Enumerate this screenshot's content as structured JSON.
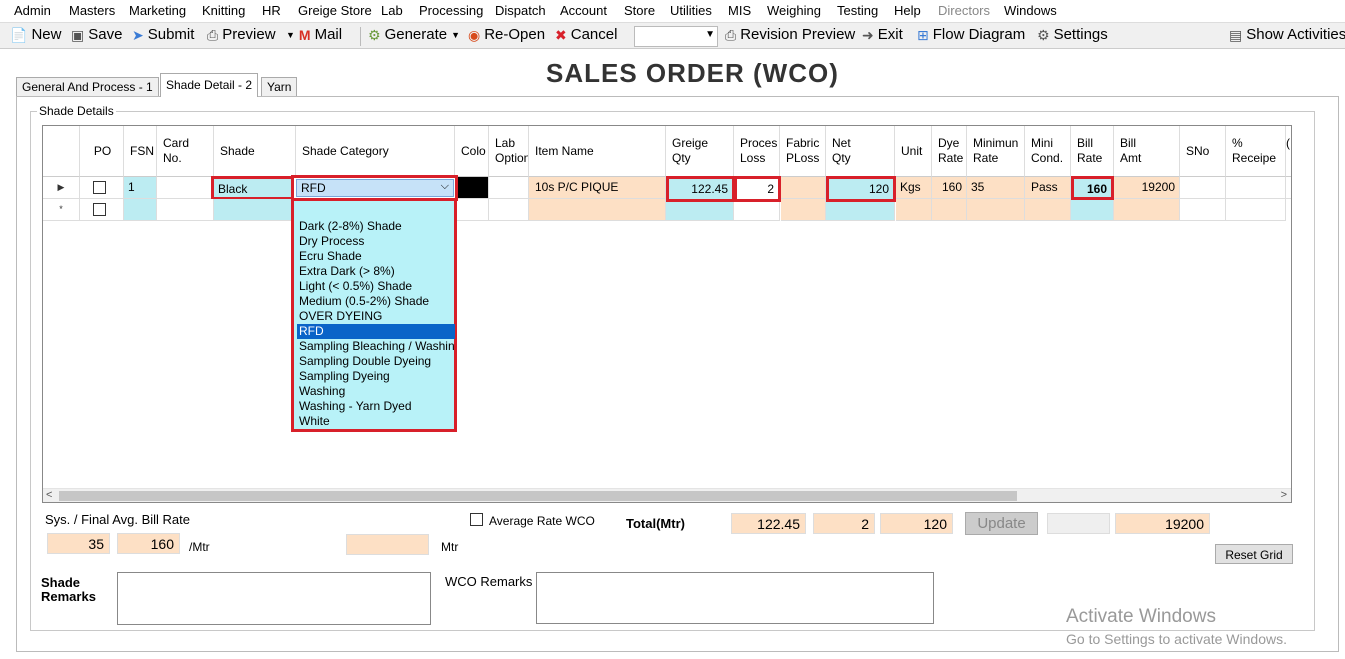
{
  "menu": [
    "Admin",
    "Masters",
    "Marketing",
    "Knitting",
    "HR",
    "Greige Store",
    "Lab",
    "Processing",
    "Dispatch",
    "Account",
    "Store",
    "Utilities",
    "MIS",
    "Weighing",
    "Testing",
    "Help",
    "Directors",
    "Windows"
  ],
  "toolbar": {
    "new": "New",
    "save": "Save",
    "submit": "Submit",
    "preview": "Preview",
    "mail": "Mail",
    "generate": "Generate",
    "reopen": "Re-Open",
    "cancel": "Cancel",
    "revision_preview": "Revision Preview",
    "exit": "Exit",
    "flow_diagram": "Flow Diagram",
    "settings": "Settings",
    "show_activities": "Show Activities"
  },
  "title": "SALES ORDER (WCO)",
  "tabs": [
    "General And Process - 1",
    "Shade Detail - 2",
    "Yarn"
  ],
  "group_title": "Shade Details",
  "grid": {
    "headers": {
      "po": "PO",
      "fsn": "FSN",
      "card_no": "Card\nNo.",
      "shade": "Shade",
      "shade_category": "Shade Category",
      "color": "Colo",
      "lab_option": "Lab\nOption",
      "item_name": "Item Name",
      "greige_qty": "Greige\nQty",
      "process_loss": "Proces\nLoss",
      "fabric_ploss": "Fabric\nPLoss",
      "net_qty": "Net\nQty",
      "unit": "Unit",
      "dye_rate": "Dye\nRate",
      "minimum_rate": "Minimun\nRate",
      "mini_cond": "Mini\nCond.",
      "bill_rate": "Bill\nRate",
      "bill_amt": "Bill\nAmt",
      "sno": "SNo",
      "pct_receipe": "%\nReceipe",
      "extra": "("
    },
    "row1": {
      "fsn": "1",
      "shade": "Black",
      "shade_category": "RFD",
      "item_name": "10s P/C PIQUE",
      "greige_qty": "122.45",
      "process_loss": "2",
      "net_qty": "120",
      "unit": "Kgs",
      "dye_rate": "160",
      "minimum_rate": "35",
      "mini_cond": "Pass",
      "bill_rate": "160",
      "bill_amt": "19200"
    },
    "row_marker": "▶",
    "new_row_marker": "*"
  },
  "shade_category_options": [
    "",
    "Dark (2-8%) Shade",
    "Dry Process",
    "Ecru Shade",
    "Extra Dark (> 8%)",
    "Light (< 0.5%) Shade",
    "Medium (0.5-2%) Shade",
    "OVER DYEING",
    "RFD",
    "Sampling Bleaching / Washing",
    "Sampling Double Dyeing",
    "Sampling Dyeing",
    "Washing",
    "Washing - Yarn Dyed",
    "White"
  ],
  "shade_category_selected": "RFD",
  "footer": {
    "avg_rate_label": "Sys. / Final Avg. Bill Rate",
    "sys_rate": "35",
    "final_rate": "160",
    "per_mtr": "/Mtr",
    "mtr_label": "Mtr",
    "mtr_value": "",
    "average_rate_wco": "Average Rate WCO",
    "total_label": "Total(Mtr)",
    "total_greige": "122.45",
    "total_loss": "2",
    "total_net": "120",
    "update": "Update",
    "total_blank": "",
    "total_amt": "19200",
    "reset_grid": "Reset Grid",
    "shade_remarks": "Shade\nRemarks",
    "wco_remarks": "WCO Remarks"
  },
  "watermark": {
    "line1": "Activate Windows",
    "line2": "Go to Settings to activate Windows."
  },
  "colors": {
    "peach": "#fde0c5",
    "cyan": "#bcecf2",
    "highlight_red": "#d8202a",
    "selection_blue": "#0a64c8"
  }
}
